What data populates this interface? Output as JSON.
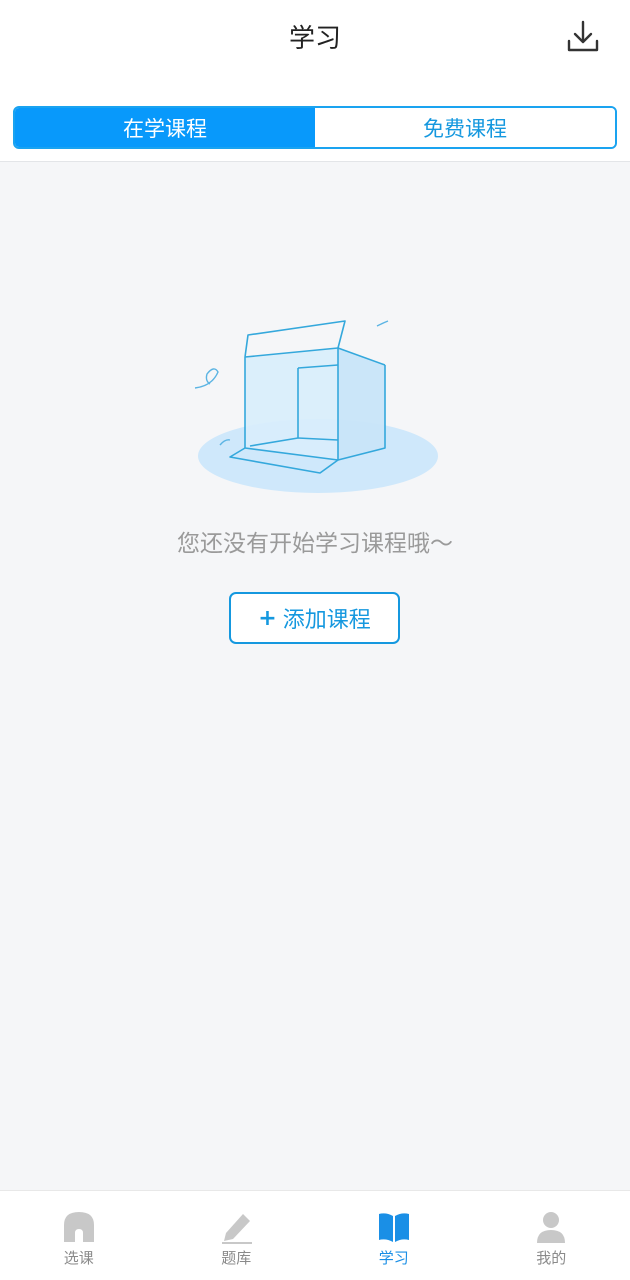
{
  "header": {
    "title": "学习",
    "download_icon": "download-icon"
  },
  "segment": {
    "tabs": [
      {
        "label": "在学课程",
        "active": true
      },
      {
        "label": "免费课程",
        "active": false
      }
    ]
  },
  "empty_state": {
    "illustration": "empty-box-illustration",
    "message": "您还没有开始学习课程哦～",
    "button_plus": "+",
    "button_label": "添加课程"
  },
  "tabbar": {
    "items": [
      {
        "label": "选课",
        "icon": "home-icon",
        "active": false
      },
      {
        "label": "题库",
        "icon": "pencil-icon",
        "active": false
      },
      {
        "label": "学习",
        "icon": "book-icon",
        "active": true
      },
      {
        "label": "我的",
        "icon": "user-icon",
        "active": false
      }
    ]
  },
  "colors": {
    "accent": "#0899fb",
    "inactive_tab": "#8a8a8a",
    "background": "#f5f6f8"
  }
}
